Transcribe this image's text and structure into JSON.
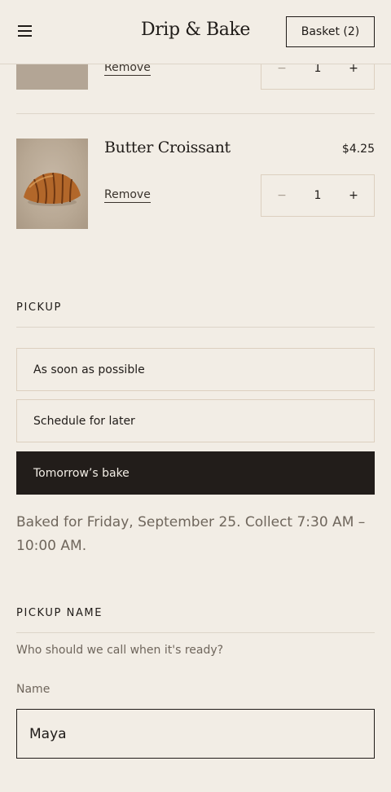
{
  "header": {
    "brand": "Drip & Bake",
    "basket_label": "Basket (2)",
    "menu_icon": "hamburger-menu-icon"
  },
  "cart": {
    "items": [
      {
        "name": "",
        "price": "",
        "remove_label": "Remove",
        "quantity": "1",
        "decrement": "−",
        "increment": "+"
      },
      {
        "name": "Butter Croissant",
        "price": "$4.25",
        "remove_label": "Remove",
        "quantity": "1",
        "decrement": "−",
        "increment": "+"
      }
    ]
  },
  "pickup": {
    "heading": "PICKUP",
    "options": [
      {
        "label": "As soon as possible",
        "selected": false
      },
      {
        "label": "Schedule for later",
        "selected": false
      },
      {
        "label": "Tomorrow’s bake",
        "selected": true
      }
    ],
    "note": "Baked for Friday, September 25. Collect 7:30 AM – 10:00 AM."
  },
  "pickup_name": {
    "heading": "PICKUP NAME",
    "help": "Who should we call when it's ready?",
    "field_label": "Name",
    "value": "Maya"
  },
  "colors": {
    "background": "#f2ede5",
    "ink": "#1f1b18",
    "selected_bg": "#221d1a",
    "border": "#dccfbf",
    "muted_text": "#6f665c"
  }
}
